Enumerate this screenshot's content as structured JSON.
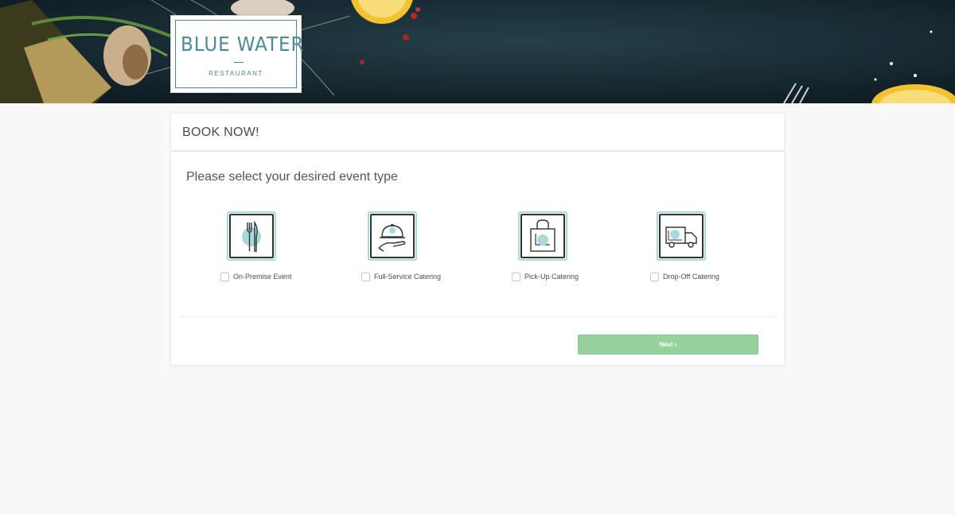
{
  "logo": {
    "name": "BLUE WATER",
    "subtitle": "RESTAURANT"
  },
  "card": {
    "title": "BOOK NOW!",
    "prompt": "Please select your desired event type"
  },
  "options": [
    {
      "label": "On-Premise Event",
      "icon": "fork-knife-icon",
      "checked": false
    },
    {
      "label": "Full-Service Catering",
      "icon": "serving-cloche-icon",
      "checked": false
    },
    {
      "label": "Pick-Up Catering",
      "icon": "shopping-bag-icon",
      "checked": false
    },
    {
      "label": "Drop-Off Catering",
      "icon": "delivery-truck-icon",
      "checked": false
    }
  ],
  "next_button": {
    "label": "Next",
    "icon": "chevron-right-icon",
    "chevron": "›"
  },
  "colors": {
    "brand": "#4d8a95",
    "accent_teal": "#a9d9db",
    "button_green": "#96d09a"
  }
}
